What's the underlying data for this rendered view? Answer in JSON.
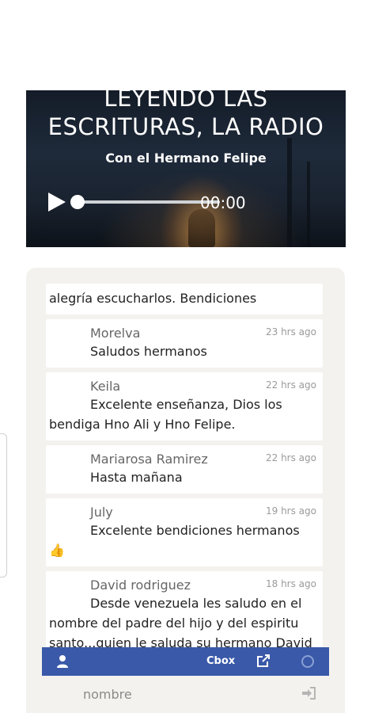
{
  "player": {
    "title": "LEYENDO LAS ESCRITURAS, LA RADIO",
    "subtitle": "Con el Hermano Felipe",
    "time": "00:00",
    "progress": 0
  },
  "chat": {
    "messages": [
      {
        "user": "",
        "time": "",
        "text": "alegría escucharlos. Bendiciones"
      },
      {
        "user": "Morelva",
        "time": "23 hrs ago",
        "text": "Saludos hermanos"
      },
      {
        "user": "Keila",
        "time": "22 hrs ago",
        "text": "Excelente enseñanza, Dios los bendiga Hno Ali y Hno Felipe."
      },
      {
        "user": "Mariarosa Ramirez",
        "time": "22 hrs ago",
        "text": "Hasta mañana"
      },
      {
        "user": "July",
        "time": "19 hrs ago",
        "text": "Excelente bendiciones hermanos 👍"
      },
      {
        "user": "David rodriguez",
        "time": "18 hrs ago",
        "text": "Desde venezuela les saludo en el nombre del padre del hijo y del espiritu santo...quien le saluda su hermano David rodriguez"
      }
    ],
    "toolbar": {
      "brand": "Cbox",
      "user_icon": "user-icon",
      "external_icon": "external-link-icon",
      "status_icon": "status-circle-icon"
    },
    "name_input": {
      "placeholder": "nombre",
      "value": ""
    },
    "login_icon": "sign-in-icon"
  },
  "colors": {
    "toolbar": "#3a59a8",
    "chat_bg": "#f4f2ee"
  }
}
